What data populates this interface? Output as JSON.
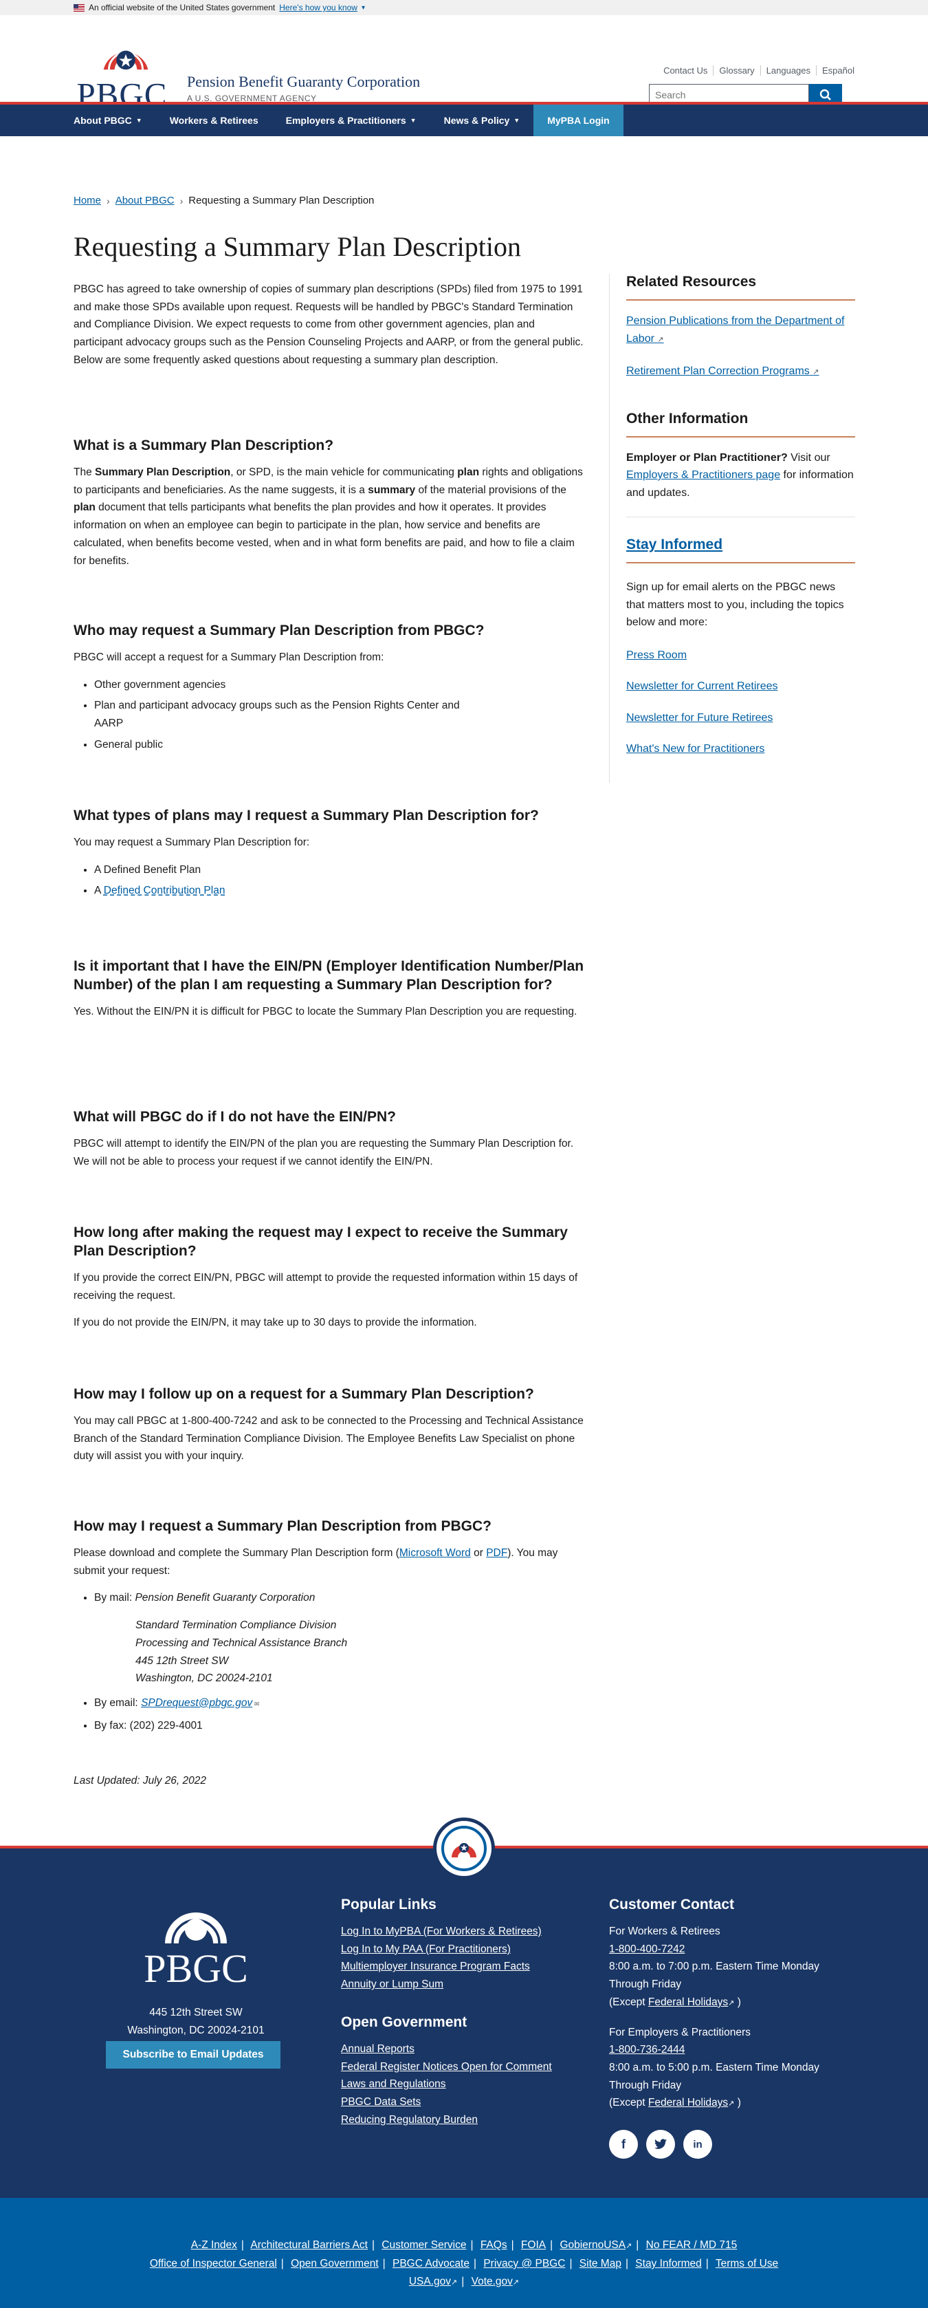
{
  "gov_banner": {
    "text": "An official website of the United States government",
    "link": "Here's how you know"
  },
  "header": {
    "logo_text": "PBGC",
    "org_name": "Pension Benefit Guaranty Corporation",
    "agency_tag": "A U.S. GOVERNMENT AGENCY",
    "util_links": [
      "Contact Us",
      "Glossary",
      "Languages",
      "Español"
    ],
    "search_placeholder": "Search"
  },
  "nav": {
    "items": [
      {
        "label": "About PBGC",
        "dropdown": true
      },
      {
        "label": "Workers & Retirees",
        "dropdown": false
      },
      {
        "label": "Employers & Practitioners",
        "dropdown": true
      },
      {
        "label": "News & Policy",
        "dropdown": true
      }
    ],
    "mypba": "MyPBA Login"
  },
  "breadcrumb": {
    "home": "Home",
    "about": "About PBGC",
    "current": "Requesting a Summary Plan Description"
  },
  "page_title": "Requesting a Summary Plan Description",
  "main": {
    "intro": "PBGC has agreed to take ownership of copies of summary plan descriptions (SPDs) filed from 1975 to 1991 and make those SPDs available upon request.  Requests will be handled by PBGC's Standard Termination and Compliance Division. We expect requests to come from other government agencies, plan and participant advocacy groups such as the Pension Counseling Projects and AARP, or from the general public. Below are some frequently asked questions about requesting a summary plan description.",
    "s1": {
      "heading": "What is a Summary Plan Description?",
      "p1": "The ",
      "b1": "Summary Plan Description",
      "p2": ", or SPD, is the main vehicle for communicating ",
      "b2": "plan",
      "p3": " rights and obligations to participants and beneficiaries. As the name suggests, it is a ",
      "b3": "summary",
      "p4": " of the material provisions of the ",
      "b4": "plan",
      "p5": " document that tells participants what benefits the plan provides and how it operates. It provides information on when an employee can begin to participate in the plan, how service and benefits are calculated, when benefits become vested, when and in what form benefits are paid, and how to file a claim for benefits."
    },
    "s2": {
      "heading": "Who may request a Summary Plan Description from PBGC?",
      "text": "PBGC will accept a request for a Summary Plan Description from:",
      "items": [
        "Other government agencies",
        "Plan and participant advocacy groups such as the Pension Rights Center and AARP",
        "General public"
      ]
    },
    "s3": {
      "heading": "What types of plans may I request a Summary Plan Description for?",
      "text": "You may request a Summary Plan Description for:",
      "item1": "A Defined Benefit Plan",
      "item2_prefix": "A ",
      "item2_link": "Defined Contribution Plan"
    },
    "s4": {
      "heading": "Is it important that I have the EIN/PN (Employer Identification Number/Plan Number) of the plan I am requesting a Summary Plan Description for?",
      "text": "Yes.  Without the EIN/PN it is difficult for PBGC to locate the Summary Plan Description you are requesting."
    },
    "s5": {
      "heading": "What will PBGC do if I do not have the EIN/PN?",
      "text": "PBGC will attempt to identify the EIN/PN of the plan you are requesting the Summary Plan Description for.  We will not be able to process your request if we cannot identify the EIN/PN."
    },
    "s6": {
      "heading": "How long after making the request may I expect to receive the Summary Plan Description?",
      "p1": "If you provide the correct EIN/PN, PBGC will attempt to provide the requested information within 15 days of receiving the request.",
      "p2": "If you do not provide the EIN/PN, it may take up to 30 days to provide the information."
    },
    "s7": {
      "heading": "How may I follow up on a request for a Summary Plan Description?",
      "text": "You may call PBGC at 1-800-400-7242 and ask to be connected to the Processing and Technical Assistance Branch of the Standard Termination Compliance Division.  The Employee Benefits Law Specialist on phone duty will assist you with your inquiry."
    },
    "s8": {
      "heading": "How may I request a Summary Plan Description from PBGC?",
      "p_a": "Please download and complete the Summary Plan Description form (",
      "link_word": "Microsoft Word",
      "p_or": " or ",
      "link_pdf": "PDF",
      "p_b": "). You may submit your request:",
      "mail_label": "By mail: ",
      "mail_org": "Pension Benefit Guaranty Corporation",
      "addr1": "Standard Termination Compliance Division",
      "addr2": "Processing and Technical Assistance Branch",
      "addr3": "445 12th Street SW",
      "addr4": "Washington, DC 20024-2101",
      "email_label": "By email:  ",
      "email": "SPDrequest@pbgc.gov",
      "fax": "By fax: (202) 229-4001"
    },
    "last_updated": "Last Updated: July 26, 2022"
  },
  "sidebar": {
    "related_heading": "Related Resources",
    "related_links": [
      "Pension Publications from the Department of Labor",
      "Retirement Plan Correction Programs"
    ],
    "other_heading": "Other Information",
    "other_bold": "Employer or Plan Practitioner?",
    "other_text1": " Visit our ",
    "other_link": "Employers & Practitioners page",
    "other_text2": " for information and updates.",
    "stay_heading": "Stay Informed",
    "stay_text": "Sign up for email alerts on the PBGC news that matters most to you, including the topics below and more:",
    "stay_links": [
      "Press Room",
      "Newsletter for Current Retirees",
      "Newsletter for Future Retirees",
      "What's New for Practitioners"
    ]
  },
  "footer": {
    "logo_text": "PBGC",
    "addr1": "445 12th Street SW",
    "addr2": "Washington, DC 20024-2101",
    "subscribe": "Subscribe to Email Updates",
    "popular_heading": "Popular Links",
    "popular_links": [
      "Log In to MyPBA (For Workers & Retirees)",
      "Log In to My PAA (For Practitioners)",
      "Multiemployer Insurance Program Facts",
      "Annuity or Lump Sum"
    ],
    "open_heading": "Open Government",
    "open_links": [
      "Annual Reports",
      "Federal Register Notices Open for Comment",
      "Laws and Regulations",
      "PBGC Data Sets",
      "Reducing Regulatory Burden"
    ],
    "contact_heading": "Customer Contact",
    "c1_label": "For Workers & Retirees",
    "c1_phone": "1-800-400-7242",
    "c1_hours": "8:00 a.m. to 7:00 p.m. Eastern Time Monday Through Friday",
    "c2_label": "For Employers & Practitioners",
    "c2_phone": "1-800-736-2444",
    "c2_hours": "8:00 a.m. to 5:00 p.m. Eastern Time Monday Through Friday",
    "except_prefix": "(Except ",
    "except_link": "Federal Holidays",
    "except_suffix": " )",
    "social": [
      "facebook-icon",
      "twitter-icon",
      "linkedin-icon"
    ],
    "bottom_row1": [
      "A-Z Index",
      "Architectural Barriers Act",
      "Customer Service",
      "FAQs",
      "FOIA",
      "GobiernoUSA",
      "No FEAR / MD 715"
    ],
    "bottom_row2": [
      "Office of Inspector General",
      "Open Government",
      "PBGC Advocate",
      "Privacy @ PBGC",
      "Site Map",
      "Stay Informed",
      "Terms of Use"
    ],
    "bottom_row3": [
      "USA.gov",
      "Vote.gov"
    ]
  },
  "colors": {
    "navy": "#1a3664",
    "red": "#d83933",
    "link": "#005ea2",
    "accent": "#2e8ab8",
    "rule": "#c9815b"
  }
}
